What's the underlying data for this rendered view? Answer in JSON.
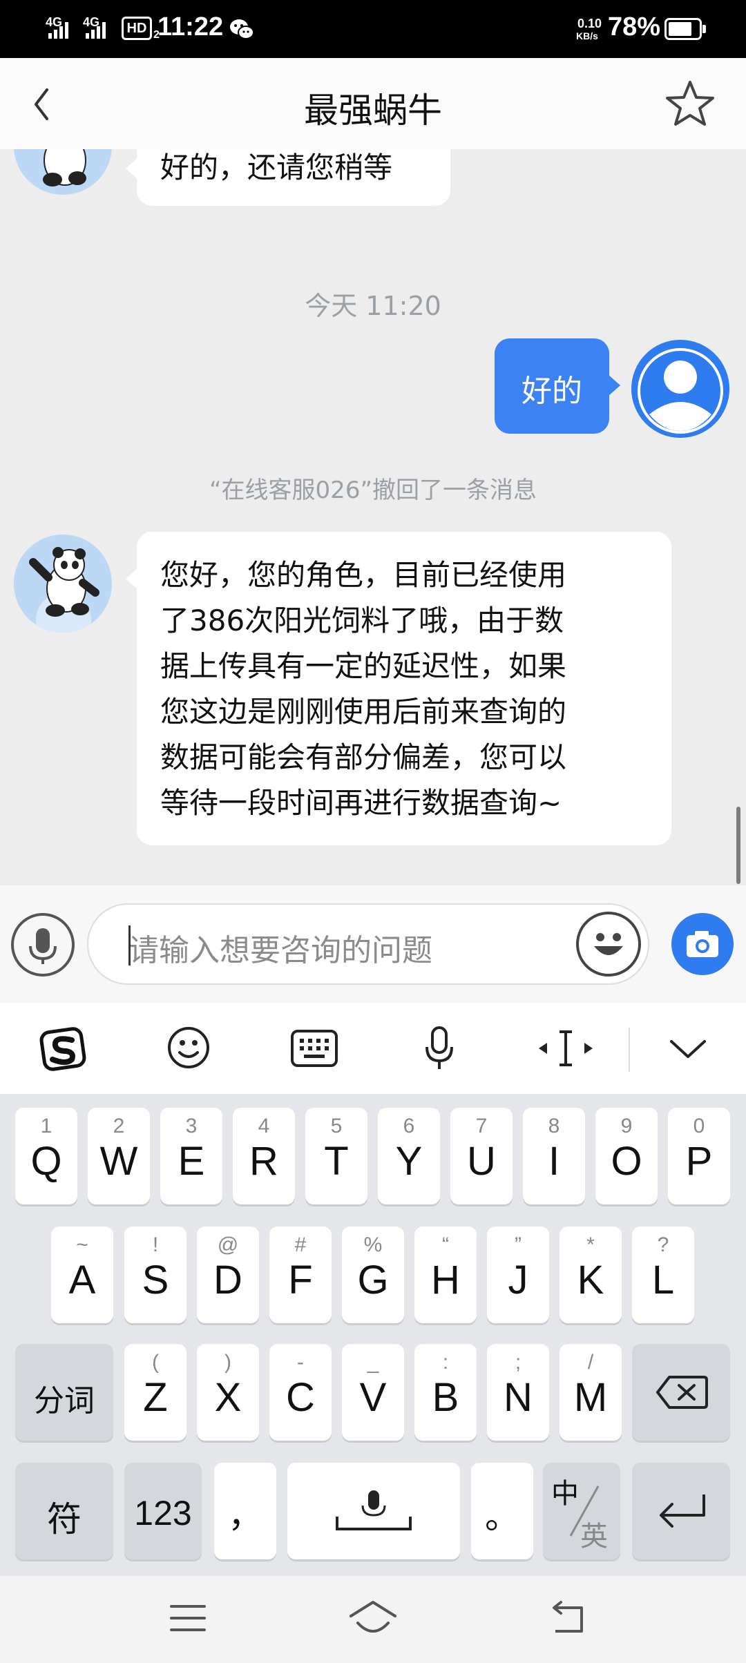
{
  "status": {
    "sig1": "4G",
    "sig2": "4G",
    "hd": "HD",
    "hd_sub": "2",
    "time": "11:22",
    "net_speed_top": "0.10",
    "net_speed_unit": "KB/s",
    "battery": "78%",
    "battery_level": 0.78
  },
  "header": {
    "title": "最强蜗牛"
  },
  "chat": {
    "prev_message_tail": "好的，还请您稍等",
    "timestamp": "今天 11:20",
    "user_message": "好的",
    "recall_notice": "“在线客服026”撤回了一条消息",
    "agent_lines": [
      "您好，您的角色，目前已经使用",
      "了386次阳光饲料了哦，由于数",
      "据上传具有一定的延迟性，如果",
      "您这边是刚刚使用后前来查询的",
      "数据可能会有部分偏差，您可以",
      "等待一段时间再进行数据查询~"
    ]
  },
  "input": {
    "placeholder": "请输入想要咨询的问题"
  },
  "keyboard": {
    "row1": [
      {
        "hint": "1",
        "key": "Q"
      },
      {
        "hint": "2",
        "key": "W"
      },
      {
        "hint": "3",
        "key": "E"
      },
      {
        "hint": "4",
        "key": "R"
      },
      {
        "hint": "5",
        "key": "T"
      },
      {
        "hint": "6",
        "key": "Y"
      },
      {
        "hint": "7",
        "key": "U"
      },
      {
        "hint": "8",
        "key": "I"
      },
      {
        "hint": "9",
        "key": "O"
      },
      {
        "hint": "0",
        "key": "P"
      }
    ],
    "row2": [
      {
        "hint": "~",
        "key": "A"
      },
      {
        "hint": "!",
        "key": "S"
      },
      {
        "hint": "@",
        "key": "D"
      },
      {
        "hint": "#",
        "key": "F"
      },
      {
        "hint": "%",
        "key": "G"
      },
      {
        "hint": "“",
        "key": "H"
      },
      {
        "hint": "”",
        "key": "J"
      },
      {
        "hint": "*",
        "key": "K"
      },
      {
        "hint": "?",
        "key": "L"
      }
    ],
    "row3": [
      {
        "hint": "(",
        "key": "Z"
      },
      {
        "hint": ")",
        "key": "X"
      },
      {
        "hint": "-",
        "key": "C"
      },
      {
        "hint": "_",
        "key": "V"
      },
      {
        "hint": ":",
        "key": "B"
      },
      {
        "hint": ";",
        "key": "N"
      },
      {
        "hint": "/",
        "key": "M"
      }
    ],
    "fenci": "分词",
    "symbols": "符",
    "numbers": "123",
    "comma": "，",
    "period": "。",
    "lang_zh": "中",
    "lang_en": "英"
  }
}
